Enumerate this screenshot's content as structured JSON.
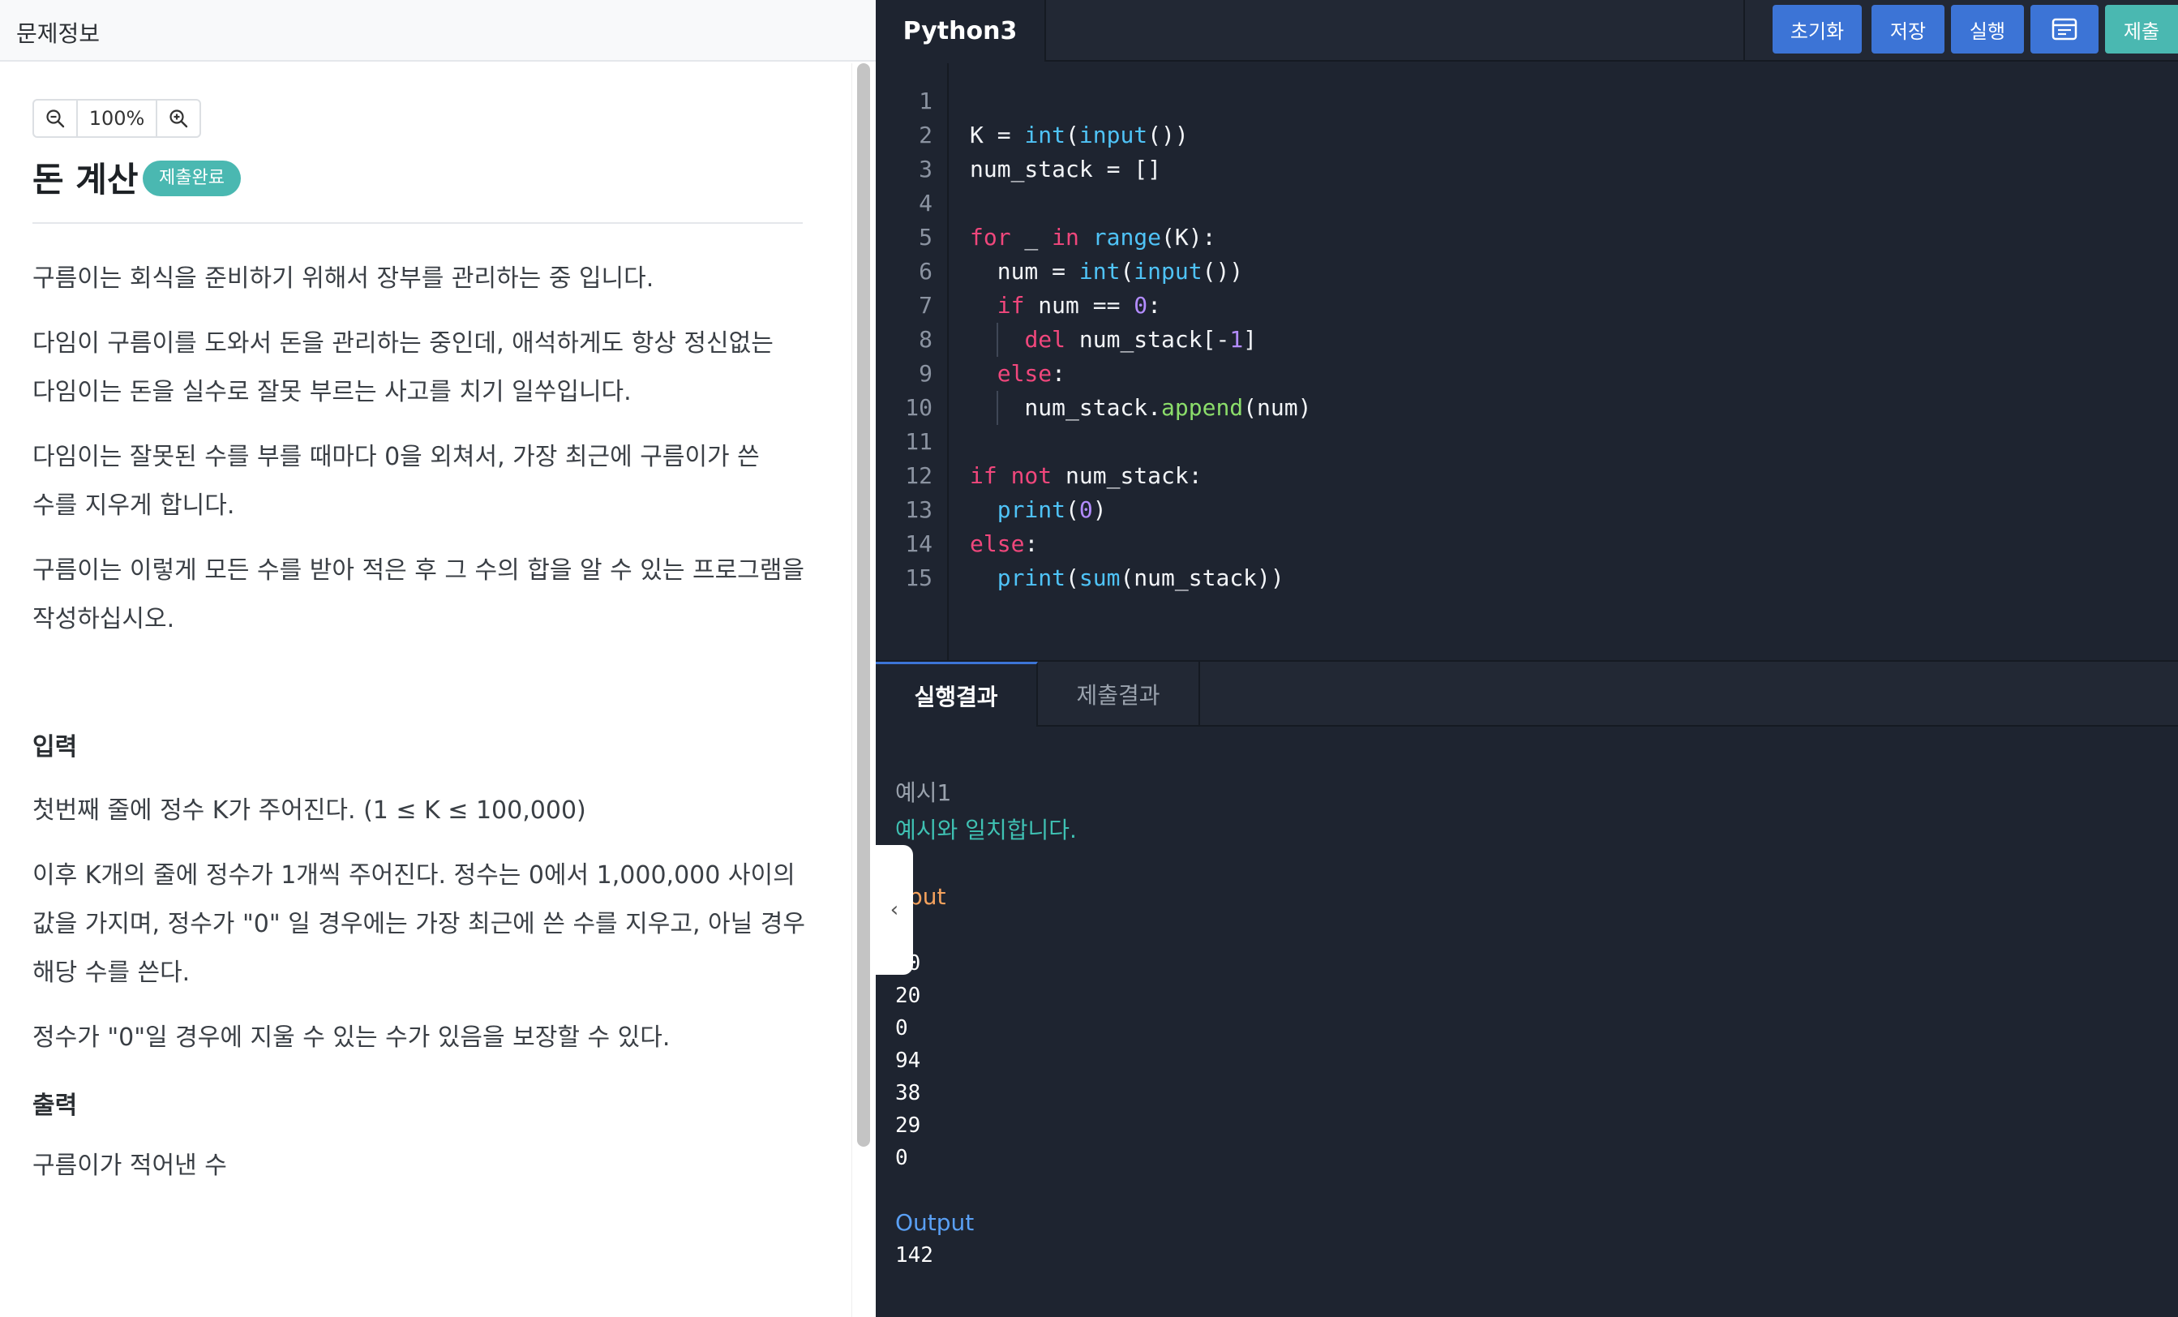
{
  "left_panel": {
    "header_title": "문제정보",
    "zoom_level": "100%",
    "problem_title": "돈 계산",
    "status_badge": "제출완료",
    "description": [
      "구름이는 회식을 준비하기 위해서 장부를 관리하는 중 입니다.",
      "다임이 구름이를 도와서 돈을 관리하는 중인데, 애석하게도 항상 정신없는",
      "다임이는 돈을 실수로 잘못 부르는 사고를 치기 일쑤입니다.",
      "다임이는 잘못된 수를 부를 때마다 0을 외쳐서, 가장 최근에 구름이가 쓴",
      "수를 지우게 합니다.",
      "구름이는 이렇게 모든 수를 받아 적은 후 그 수의 합을 알 수 있는 프로그램을",
      "작성하십시오."
    ],
    "input_heading": "입력",
    "input_lines": [
      "첫번째 줄에 정수 K가 주어진다. (1 ≤ K ≤ 100,000)",
      "이후 K개의 줄에 정수가 1개씩 주어진다. 정수는 0에서 1,000,000 사이의",
      "값을 가지며, 정수가 \"0\" 일 경우에는 가장 최근에 쓴 수를 지우고, 아닐 경우",
      "해당 수를 쓴다.",
      "정수가 \"0\"일 경우에 지울 수 있는 수가 있음을 보장할 수 있다."
    ],
    "output_heading": "출력",
    "output_lines": [
      "구름이가 적어낸 수"
    ]
  },
  "editor": {
    "language": "Python3",
    "toolbar": {
      "reset": "초기화",
      "save": "저장",
      "run": "실행",
      "submit": "제출"
    },
    "line_numbers": [
      "1",
      "2",
      "3",
      "4",
      "5",
      "6",
      "7",
      "8",
      "9",
      "10",
      "11",
      "12",
      "13",
      "14",
      "15"
    ]
  },
  "results": {
    "tab_run": "실행결과",
    "tab_submit": "제출결과",
    "example_label": "예시1",
    "match_message": "예시와 일치합니다.",
    "input_label": "put",
    "input_values": [
      "10",
      "20",
      "0",
      "94",
      "38",
      "29",
      "0"
    ],
    "output_label": "Output",
    "output_value": "142"
  },
  "colors": {
    "badge": "#4ab8b1",
    "button": "#3c74d6",
    "submit_button": "#4ab8b1",
    "editor_bg": "#1e2430",
    "keyword": "#f0477c",
    "function": "#4fc3f7",
    "number": "#b38cff",
    "match_text": "#3fc1b3",
    "input_label": "#f5a25d",
    "output_label": "#5aa0f5"
  },
  "icons": {
    "zoom_out": "zoom-out-icon",
    "zoom_in": "zoom-in-icon",
    "layout": "layout-icon",
    "collapse": "chevron-left-icon"
  }
}
